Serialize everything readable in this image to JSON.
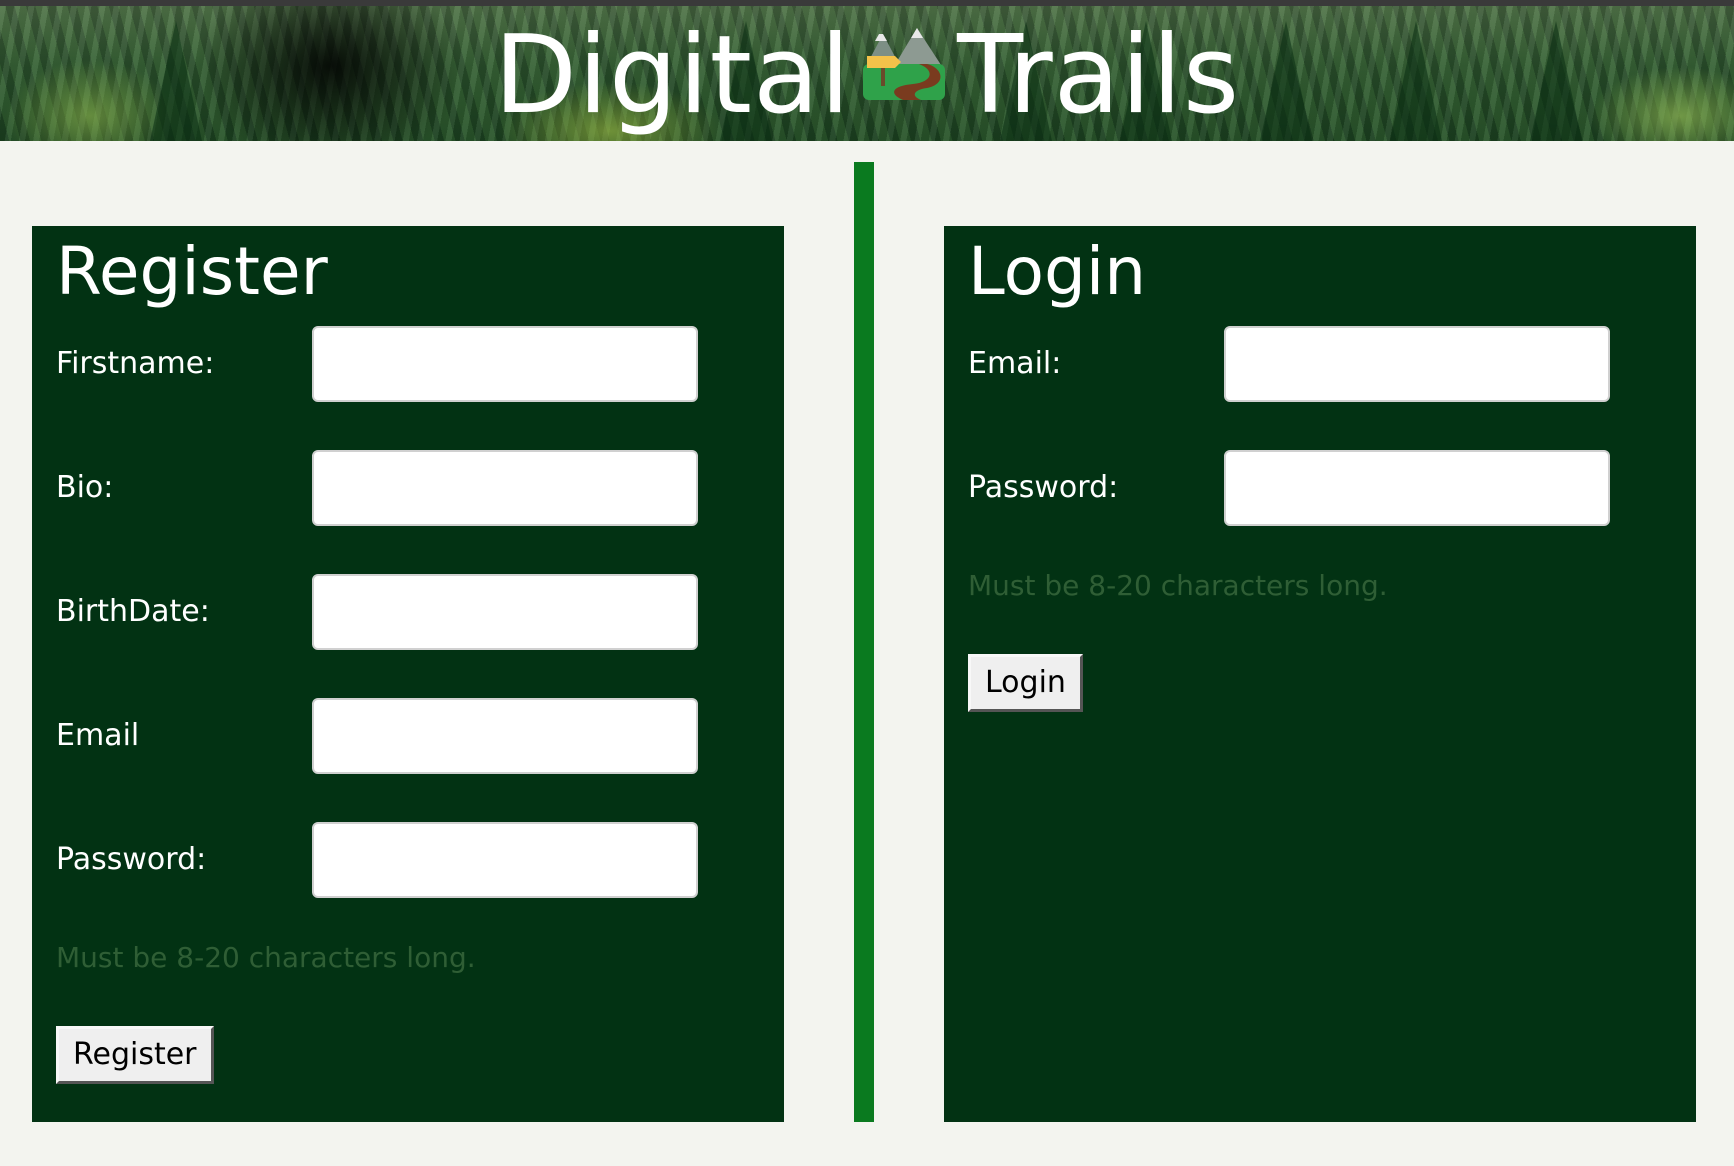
{
  "header": {
    "title_left": "Digital",
    "title_right": "Trails",
    "logo_icon": "trail-sign-mountain-icon"
  },
  "register": {
    "heading": "Register",
    "fields": [
      {
        "label": "Firstname:",
        "value": ""
      },
      {
        "label": "Bio:",
        "value": ""
      },
      {
        "label": "BirthDate:",
        "value": ""
      },
      {
        "label": "Email",
        "value": ""
      },
      {
        "label": "Password:",
        "value": ""
      }
    ],
    "hint": "Must be 8-20 characters long.",
    "button_label": "Register"
  },
  "login": {
    "heading": "Login",
    "fields": [
      {
        "label": "Email:",
        "value": ""
      },
      {
        "label": "Password:",
        "value": ""
      }
    ],
    "hint": "Must be 8-20 characters long.",
    "button_label": "Login"
  },
  "colors": {
    "background": "#f3f4ef",
    "panel": "#023213",
    "divider": "#0a7a1f",
    "hint": "#2f5e35"
  }
}
